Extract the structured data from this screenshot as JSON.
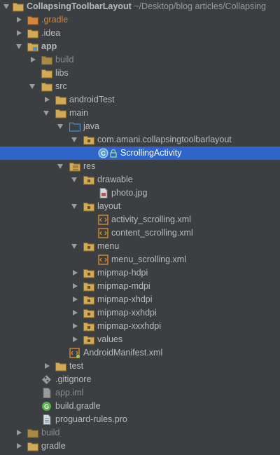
{
  "project": {
    "name": "CollapsingToolbarLayout",
    "path": "~/Desktop/blog articles/Collapsing"
  },
  "tree": {
    "gradle_hidden": ".gradle",
    "idea": ".idea",
    "app": "app",
    "app_build": "build",
    "libs": "libs",
    "src": "src",
    "androidTest": "androidTest",
    "main": "main",
    "java": "java",
    "package": "com.amani.collapsingtoolbarlayout",
    "scrolling_activity": "ScrollingActivity",
    "res": "res",
    "drawable": "drawable",
    "photo": "photo.jpg",
    "layout": "layout",
    "activity_scrolling": "activity_scrolling.xml",
    "content_scrolling": "content_scrolling.xml",
    "menu": "menu",
    "menu_scrolling": "menu_scrolling.xml",
    "mipmap_hdpi": "mipmap-hdpi",
    "mipmap_mdpi": "mipmap-mdpi",
    "mipmap_xhdpi": "mipmap-xhdpi",
    "mipmap_xxhdpi": "mipmap-xxhdpi",
    "mipmap_xxxhdpi": "mipmap-xxxhdpi",
    "values": "values",
    "manifest": "AndroidManifest.xml",
    "test": "test",
    "gitignore": ".gitignore",
    "app_iml": "app.iml",
    "build_gradle": "build.gradle",
    "proguard": "proguard-rules.pro",
    "root_build": "build",
    "root_gradle": "gradle"
  },
  "colors": {
    "background": "#3c3f41",
    "selection": "#2f65ca",
    "folder": "#d1aa58",
    "excluded_folder": "#d3863b",
    "source_folder": "#4a8fd6",
    "text": "#bbbbbb"
  },
  "icons": {
    "folder": "folder-icon",
    "module": "module-folder-icon",
    "class": "java-class-icon",
    "xml": "xml-file-icon",
    "image": "image-file-icon",
    "git": "git-icon",
    "gradle": "gradle-icon",
    "text": "text-file-icon"
  }
}
